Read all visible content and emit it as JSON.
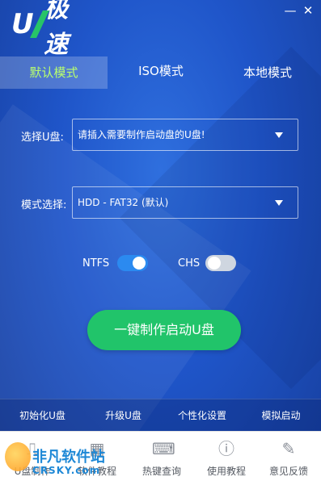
{
  "app": {
    "logo_text": "U极速"
  },
  "window": {
    "minimize_glyph": "—",
    "close_glyph": "✕"
  },
  "tabs": [
    {
      "label": "默认模式",
      "active": true
    },
    {
      "label": "ISO模式",
      "active": false
    },
    {
      "label": "本地模式",
      "active": false
    }
  ],
  "form": {
    "usb_label": "选择U盘:",
    "usb_value": "请插入需要制作启动盘的U盘!",
    "mode_label": "模式选择:",
    "mode_value": "HDD - FAT32 (默认)"
  },
  "toggles": {
    "ntfs": {
      "label": "NTFS",
      "on": true
    },
    "chs": {
      "label": "CHS",
      "on": false
    }
  },
  "main_button": "一键制作启动U盘",
  "bottom_links": [
    "初始化U盘",
    "升级U盘",
    "个性化设置",
    "模拟启动"
  ],
  "footer": [
    {
      "label": "U盘制作",
      "icon": "usb-icon"
    },
    {
      "label": "软件教程",
      "icon": "grid-icon"
    },
    {
      "label": "热键查询",
      "icon": "keyboard-icon"
    },
    {
      "label": "使用教程",
      "icon": "help-icon"
    },
    {
      "label": "意见反馈",
      "icon": "edit-icon"
    }
  ],
  "watermark": {
    "title": "非凡软件站",
    "subtitle": "CRSKY.com"
  },
  "colors": {
    "accent_green": "#21c46a",
    "toggle_on": "#2b8af0",
    "active_tab_text": "#b8ff6e"
  }
}
